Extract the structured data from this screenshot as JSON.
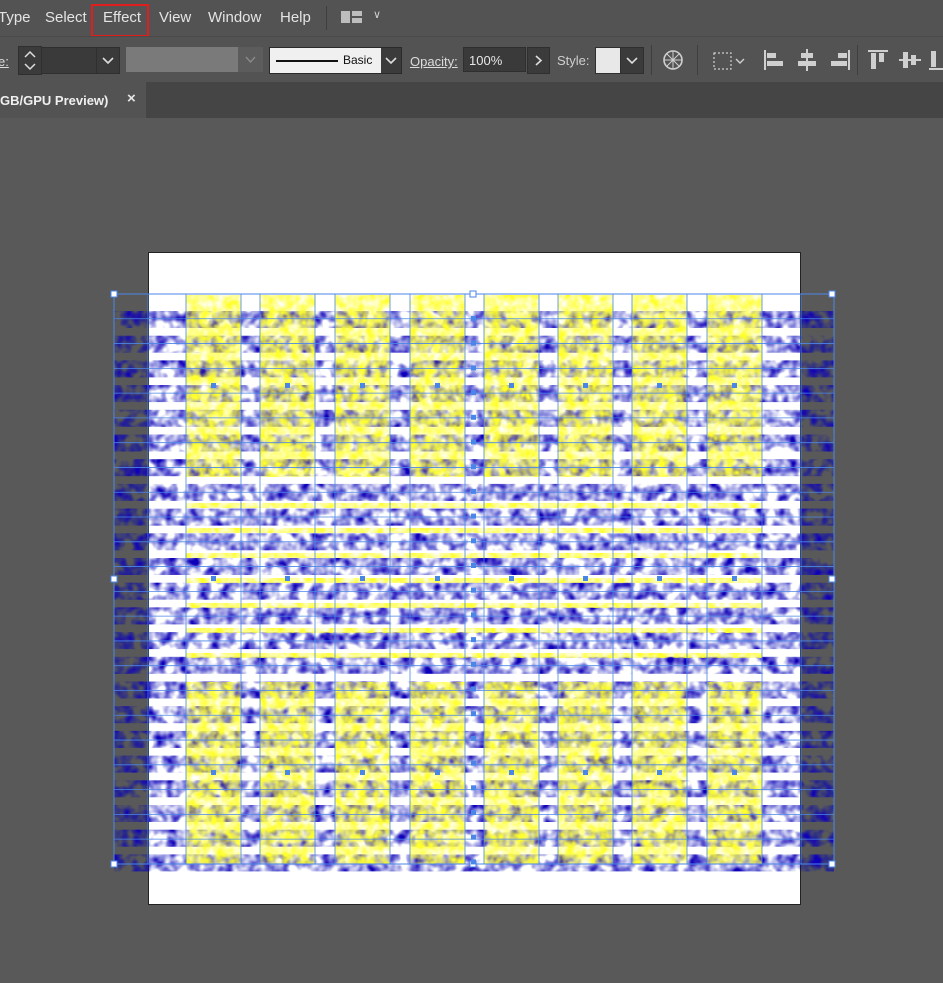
{
  "menu": {
    "items": [
      "Type",
      "Select",
      "Effect",
      "View",
      "Window",
      "Help"
    ],
    "highlighted": "Effect"
  },
  "control_bar": {
    "stroke_label_fragment": "e:",
    "stroke_style": "Basic",
    "opacity_label": "Opacity:",
    "opacity_value": "100%",
    "style_label": "Style:"
  },
  "document_tab": {
    "title": "GB/GPU Preview)",
    "close_glyph": "×"
  },
  "icons": [
    "workspace-switcher-icon",
    "chevron-down-icon",
    "stepper-icon",
    "globe-icon",
    "align-options-icon",
    "align-left-icon",
    "align-hcenter-icon",
    "align-right-icon",
    "align-top-icon",
    "align-vcenter-icon",
    "align-bottom-icon"
  ],
  "colors": {
    "ui_bg": "#535353",
    "canvas_bg": "#595959",
    "highlight_red": "#e21d1d",
    "artwork_blue": "#0a00b8",
    "artwork_yellow": "#ffff2a",
    "selection_blue": "#4a86e8"
  }
}
